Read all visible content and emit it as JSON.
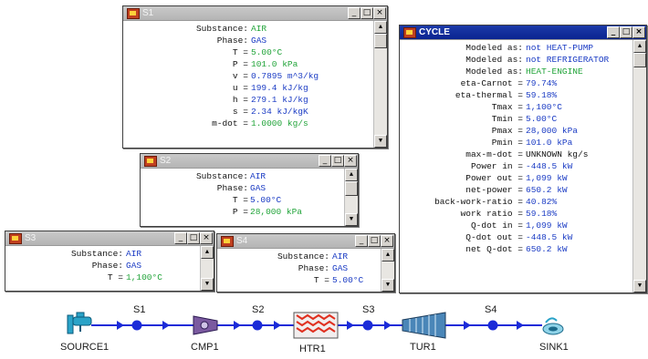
{
  "s1_window": {
    "title": "S1",
    "rows": [
      {
        "label": "Substance:",
        "value": "AIR",
        "color": "green"
      },
      {
        "label": "Phase:",
        "value": "GAS",
        "color": "blue"
      },
      {
        "label": "T =",
        "value": "5.00°C",
        "color": "green"
      },
      {
        "label": "P =",
        "value": "101.0 kPa",
        "color": "green"
      },
      {
        "label": "v =",
        "value": "0.7895 m^3/kg",
        "color": "blue"
      },
      {
        "label": "u =",
        "value": "199.4 kJ/kg",
        "color": "blue"
      },
      {
        "label": "h =",
        "value": "279.1 kJ/kg",
        "color": "blue"
      },
      {
        "label": "s =",
        "value": "2.34 kJ/kgK",
        "color": "blue"
      },
      {
        "label": "m-dot =",
        "value": "1.0000 kg/s",
        "color": "green"
      }
    ]
  },
  "s2_window": {
    "title": "S2",
    "rows": [
      {
        "label": "Substance:",
        "value": "AIR",
        "color": "blue"
      },
      {
        "label": "Phase:",
        "value": "GAS",
        "color": "blue"
      },
      {
        "label": "T =",
        "value": "5.00°C",
        "color": "blue"
      },
      {
        "label": "P =",
        "value": "28,000 kPa",
        "color": "green"
      }
    ]
  },
  "s3_window": {
    "title": "S3",
    "rows": [
      {
        "label": "Substance:",
        "value": "AIR",
        "color": "blue"
      },
      {
        "label": "Phase:",
        "value": "GAS",
        "color": "blue"
      },
      {
        "label": "T =",
        "value": "1,100°C",
        "color": "green"
      }
    ]
  },
  "s4_window": {
    "title": "S4",
    "rows": [
      {
        "label": "Substance:",
        "value": "AIR",
        "color": "blue"
      },
      {
        "label": "Phase:",
        "value": "GAS",
        "color": "blue"
      },
      {
        "label": "T =",
        "value": "5.00°C",
        "color": "blue"
      }
    ]
  },
  "cycle_window": {
    "title": "CYCLE",
    "rows": [
      {
        "label": "Modeled as:",
        "value": "not HEAT-PUMP",
        "color": "blue"
      },
      {
        "label": "Modeled as:",
        "value": "not REFRIGERATOR",
        "color": "blue"
      },
      {
        "label": "Modeled as:",
        "value": "HEAT-ENGINE",
        "color": "green"
      },
      {
        "label": "eta-Carnot =",
        "value": "79.74%",
        "color": "blue"
      },
      {
        "label": "eta-thermal =",
        "value": "59.18%",
        "color": "blue"
      },
      {
        "label": "Tmax =",
        "value": "1,100°C",
        "color": "blue"
      },
      {
        "label": "Tmin =",
        "value": "5.00°C",
        "color": "blue"
      },
      {
        "label": "Pmax =",
        "value": "28,000 kPa",
        "color": "blue"
      },
      {
        "label": "Pmin =",
        "value": "101.0 kPa",
        "color": "blue"
      },
      {
        "label": "max-m-dot =",
        "value": "UNKNOWN kg/s",
        "color": "black"
      },
      {
        "label": "Power in =",
        "value": "-448.5 kW",
        "color": "blue"
      },
      {
        "label": "Power out =",
        "value": "1,099 kW",
        "color": "blue"
      },
      {
        "label": "net-power =",
        "value": "650.2 kW",
        "color": "blue"
      },
      {
        "label": "back-work-ratio =",
        "value": "40.82%",
        "color": "blue"
      },
      {
        "label": "work ratio =",
        "value": "59.18%",
        "color": "blue"
      },
      {
        "label": "Q-dot in =",
        "value": "1,099 kW",
        "color": "blue"
      },
      {
        "label": "Q-dot out =",
        "value": "-448.5 kW",
        "color": "blue"
      },
      {
        "label": "net Q-dot =",
        "value": "650.2 kW",
        "color": "blue"
      }
    ]
  },
  "window_buttons": {
    "minimize": "_",
    "maximize": "□",
    "close": "×"
  },
  "scroll_arrows": {
    "up": "▲",
    "down": "▼"
  },
  "diagram": {
    "streams": [
      "S1",
      "S2",
      "S3",
      "S4"
    ],
    "devices": [
      "SOURCE1",
      "CMP1",
      "HTR1",
      "TUR1",
      "SINK1"
    ]
  },
  "colors": {
    "blue": "#1a3bc4",
    "green": "#22a43a",
    "black": "#111111",
    "titlebar_active": "#0a2490",
    "flow": "#1b2bd8"
  }
}
